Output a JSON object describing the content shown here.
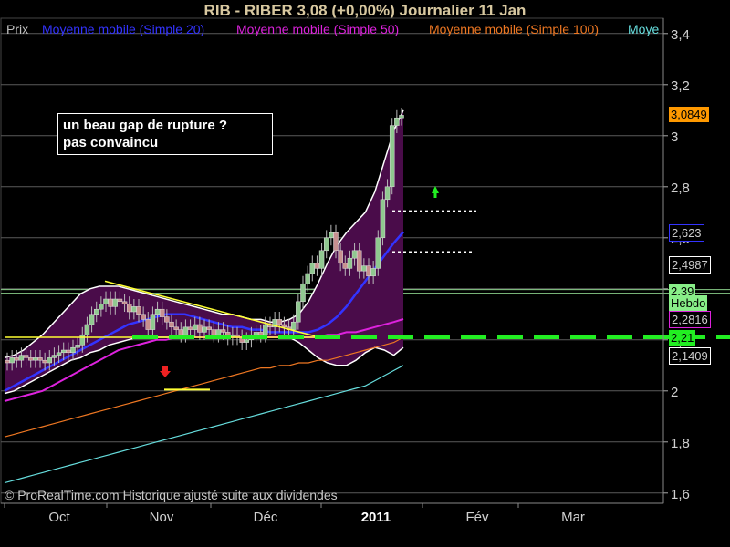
{
  "header": {
    "title": "RIB - RIBER     3,08 (+0,00%)     Journalier  11 Jan"
  },
  "legend": {
    "items": [
      {
        "label": "Prix",
        "color": "#c0c0c0"
      },
      {
        "label": "Moyenne mobile (Simple 20)",
        "color": "#3333ff"
      },
      {
        "label": "Moyenne mobile (Simple 50)",
        "color": "#dd22dd"
      },
      {
        "label": "Moyenne mobile (Simple 100)",
        "color": "#ee7722"
      },
      {
        "label": "Moye",
        "color": "#66dddd"
      }
    ]
  },
  "annotation": {
    "line1": "un beau gap  de rupture ?",
    "line2": "pas convaincu"
  },
  "footer": {
    "copyright": "© ProRealTime.com Historique ajusté suite aux dividendes"
  },
  "colors": {
    "background": "#000000",
    "grid": "#5a5a5a",
    "axis_text": "#d0d0d0",
    "bollinger_fill": "#4a0c4a",
    "bollinger_band": "#ffffff",
    "candle_up": "#90c890",
    "candle_down": "#c89090",
    "trendline": "#ffff33",
    "support_dash": "#22ee22"
  },
  "chart_data": {
    "type": "candlestick",
    "title": "RIB - RIBER     3,08 (+0,00%)     Journalier  11 Jan",
    "ylim": [
      1.56,
      3.46
    ],
    "y_ticks": [
      "1,6",
      "1,8",
      "2",
      "2,2",
      "2,4",
      "2,6",
      "2,8",
      "3",
      "3,2",
      "3,4"
    ],
    "x_ticks": [
      "Oct",
      "Nov",
      "Déc",
      "2011",
      "Fév",
      "Mar"
    ],
    "grid": true,
    "price_tags": [
      {
        "label": "3,0849",
        "value": 3.0849,
        "bg": "#ff9900",
        "fg": "#000"
      },
      {
        "label": "2,623",
        "value": 2.623,
        "bg": "#000000",
        "fg": "#cccccc",
        "border": "#3333ff"
      },
      {
        "label": "2,4987",
        "value": 2.4987,
        "bg": "#000000",
        "fg": "#cccccc",
        "border": "#ffffff"
      },
      {
        "label": "2,39",
        "value": 2.39,
        "bg": "#88ee88",
        "fg": "#000"
      },
      {
        "label": "Hebdo",
        "value": 2.345,
        "bg": "#88ee88",
        "fg": "#000"
      },
      {
        "label": "2,2816",
        "value": 2.2816,
        "bg": "#000000",
        "fg": "#cccccc",
        "border": "#dd22dd"
      },
      {
        "label": "2,21",
        "value": 2.21,
        "bg": "#22ee22",
        "fg": "#000"
      },
      {
        "label": "2,1409",
        "value": 2.1409,
        "bg": "#000000",
        "fg": "#cccccc",
        "border": "#ffffff"
      }
    ],
    "candles_open": [
      2.12,
      2.11,
      2.13,
      2.12,
      2.14,
      2.13,
      2.12,
      2.13,
      2.12,
      2.11,
      2.13,
      2.14,
      2.15,
      2.16,
      2.15,
      2.17,
      2.18,
      2.22,
      2.26,
      2.3,
      2.32,
      2.34,
      2.36,
      2.33,
      2.36,
      2.35,
      2.34,
      2.31,
      2.33,
      2.3,
      2.28,
      2.24,
      2.3,
      2.32,
      2.29,
      2.27,
      2.25,
      2.24,
      2.22,
      2.25,
      2.24,
      2.26,
      2.23,
      2.25,
      2.24,
      2.22,
      2.24,
      2.23,
      2.21,
      2.22,
      2.21,
      2.19,
      2.2,
      2.22,
      2.23,
      2.22,
      2.26,
      2.25,
      2.28,
      2.26,
      2.25,
      2.24,
      2.27,
      2.35,
      2.42,
      2.46,
      2.5,
      2.48,
      2.55,
      2.6,
      2.62,
      2.55,
      2.5,
      2.48,
      2.52,
      2.55,
      2.47,
      2.49,
      2.45,
      2.48,
      2.6,
      2.75,
      2.8,
      3.04,
      3.07
    ],
    "candles_close": [
      2.11,
      2.13,
      2.12,
      2.14,
      2.13,
      2.12,
      2.13,
      2.12,
      2.11,
      2.13,
      2.14,
      2.15,
      2.16,
      2.15,
      2.17,
      2.18,
      2.22,
      2.26,
      2.3,
      2.32,
      2.34,
      2.36,
      2.33,
      2.36,
      2.35,
      2.34,
      2.31,
      2.33,
      2.3,
      2.28,
      2.24,
      2.3,
      2.32,
      2.29,
      2.27,
      2.25,
      2.24,
      2.22,
      2.25,
      2.24,
      2.26,
      2.23,
      2.25,
      2.24,
      2.22,
      2.24,
      2.23,
      2.21,
      2.22,
      2.21,
      2.19,
      2.2,
      2.22,
      2.23,
      2.22,
      2.26,
      2.25,
      2.28,
      2.26,
      2.25,
      2.24,
      2.27,
      2.35,
      2.42,
      2.46,
      2.5,
      2.48,
      2.55,
      2.6,
      2.62,
      2.55,
      2.5,
      2.48,
      2.52,
      2.55,
      2.47,
      2.49,
      2.45,
      2.48,
      2.6,
      2.75,
      2.8,
      3.04,
      3.07,
      3.08
    ],
    "sma20": [
      2.0,
      2.02,
      2.04,
      2.06,
      2.08,
      2.1,
      2.12,
      2.14,
      2.16,
      2.18,
      2.2,
      2.22,
      2.24,
      2.26,
      2.27,
      2.28,
      2.29,
      2.3,
      2.3,
      2.3,
      2.29,
      2.28,
      2.27,
      2.26,
      2.25,
      2.25,
      2.24,
      2.24,
      2.23,
      2.23,
      2.23,
      2.23,
      2.23,
      2.24,
      2.26,
      2.29,
      2.33,
      2.38,
      2.43,
      2.48,
      2.53,
      2.58,
      2.623
    ],
    "sma50": [
      1.96,
      1.97,
      1.98,
      1.99,
      2.0,
      2.02,
      2.04,
      2.06,
      2.08,
      2.1,
      2.12,
      2.14,
      2.16,
      2.17,
      2.18,
      2.19,
      2.2,
      2.2,
      2.21,
      2.21,
      2.21,
      2.21,
      2.21,
      2.21,
      2.21,
      2.21,
      2.21,
      2.21,
      2.21,
      2.21,
      2.21,
      2.21,
      2.21,
      2.21,
      2.22,
      2.22,
      2.23,
      2.23,
      2.24,
      2.25,
      2.26,
      2.27,
      2.2816
    ],
    "sma100": [
      1.82,
      1.83,
      1.84,
      1.85,
      1.86,
      1.87,
      1.88,
      1.89,
      1.9,
      1.91,
      1.92,
      1.93,
      1.94,
      1.95,
      1.96,
      1.97,
      1.98,
      1.99,
      2.0,
      2.01,
      2.02,
      2.03,
      2.04,
      2.05,
      2.06,
      2.07,
      2.08,
      2.09,
      2.09,
      2.1,
      2.1,
      2.11,
      2.11,
      2.12,
      2.12,
      2.13,
      2.14,
      2.15,
      2.16,
      2.17,
      2.18,
      2.19,
      2.21
    ],
    "sma200": [
      1.64,
      1.65,
      1.66,
      1.67,
      1.68,
      1.69,
      1.7,
      1.71,
      1.72,
      1.73,
      1.74,
      1.75,
      1.76,
      1.77,
      1.78,
      1.79,
      1.8,
      1.81,
      1.82,
      1.83,
      1.84,
      1.85,
      1.86,
      1.87,
      1.88,
      1.89,
      1.9,
      1.91,
      1.92,
      1.93,
      1.94,
      1.95,
      1.96,
      1.97,
      1.98,
      1.99,
      2.0,
      2.01,
      2.02,
      2.04,
      2.06,
      2.08,
      2.1
    ],
    "bb_upper": [
      2.13,
      2.14,
      2.16,
      2.19,
      2.22,
      2.26,
      2.3,
      2.34,
      2.38,
      2.4,
      2.41,
      2.41,
      2.41,
      2.4,
      2.39,
      2.38,
      2.37,
      2.36,
      2.35,
      2.34,
      2.33,
      2.32,
      2.31,
      2.3,
      2.3,
      2.29,
      2.28,
      2.28,
      2.27,
      2.27,
      2.28,
      2.3,
      2.35,
      2.42,
      2.5,
      2.57,
      2.62,
      2.66,
      2.7,
      2.78,
      2.9,
      3.02,
      3.1
    ],
    "bb_lower": [
      1.99,
      2.0,
      2.02,
      2.04,
      2.06,
      2.08,
      2.1,
      2.12,
      2.13,
      2.15,
      2.16,
      2.18,
      2.19,
      2.2,
      2.21,
      2.21,
      2.21,
      2.21,
      2.21,
      2.21,
      2.21,
      2.21,
      2.21,
      2.21,
      2.21,
      2.21,
      2.21,
      2.21,
      2.21,
      2.21,
      2.21,
      2.19,
      2.16,
      2.13,
      2.11,
      2.1,
      2.1,
      2.12,
      2.15,
      2.17,
      2.16,
      2.14,
      2.17
    ]
  }
}
